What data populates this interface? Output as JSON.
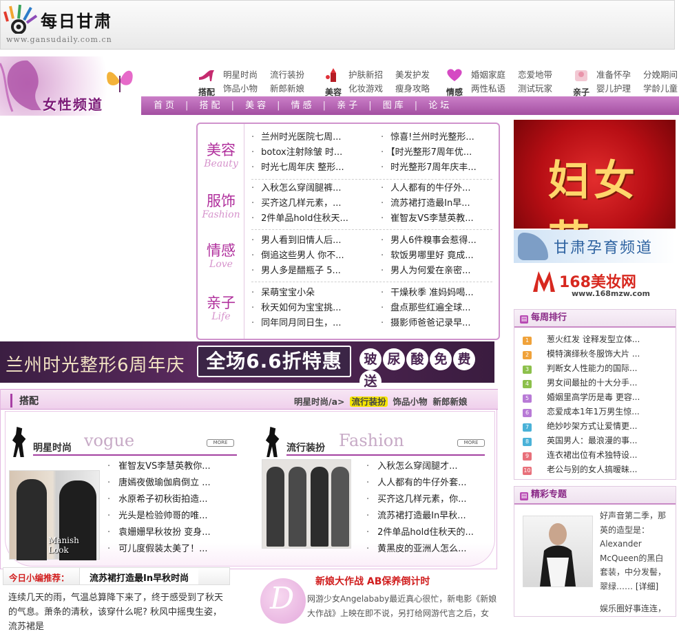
{
  "site": {
    "logo_text": "每日甘肃",
    "logo_url": "www.gansudaily.com.cn"
  },
  "channel": {
    "title": "女性频道",
    "categories": [
      {
        "icon": "high-heel-icon",
        "caption": "搭配",
        "links": [
          "明星时尚",
          "流行装扮",
          "饰品小物",
          "新郎新娘"
        ]
      },
      {
        "icon": "lipstick-icon",
        "caption": "美容",
        "links": [
          "护肤新招",
          "美发护发",
          "化妆游戏",
          "瘦身攻略"
        ]
      },
      {
        "icon": "heart-icon",
        "caption": "情感",
        "links": [
          "婚姻家庭",
          "恋爱地带",
          "两性私语",
          "测试玩家"
        ]
      },
      {
        "icon": "baby-icon",
        "caption": "亲子",
        "links": [
          "准备怀孕",
          "分娩期间",
          "婴儿护理",
          "学龄儿童"
        ]
      }
    ],
    "nav": [
      "首页",
      "搭配",
      "美容",
      "情感",
      "亲子",
      "图库",
      "论坛"
    ]
  },
  "topics": [
    {
      "cn": "美容",
      "en": "Beauty",
      "left": [
        "兰州时光医院七周...",
        "botox注射除皱 时...",
        "时光七周年庆 整形..."
      ],
      "right": [
        "惊喜!兰州时光整形...",
        "【时光整形7周年优...",
        "时光整形7周年庆丰..."
      ]
    },
    {
      "cn": "服饰",
      "en": "Fashion",
      "left": [
        "入秋怎么穿阔腿裤...",
        "买齐这几样元素，...",
        "2件单品hold住秋天..."
      ],
      "right": [
        "人人都有的牛仔外...",
        "流苏裙打造最In早...",
        "崔智友VS李慧英教..."
      ]
    },
    {
      "cn": "情感",
      "en": "Love",
      "left": [
        "男人看到旧情人后...",
        "倒追这些男人 你不...",
        "男人多是醋瓶子 5..."
      ],
      "right": [
        "男人6件糗事会惹得...",
        "软饭男哪里好 竟成...",
        "男人为何爱在亲密..."
      ]
    },
    {
      "cn": "亲子",
      "en": "Life",
      "left": [
        "呆萌宝宝小朵",
        "秋天如何为宝宝挑...",
        "同年同月同日生，..."
      ],
      "right": [
        "干燥秋季 准妈妈喝...",
        "盘点那些红遍全球...",
        "摄影师爸爸记录早..."
      ]
    }
  ],
  "right": {
    "ad1_text": "妇女节",
    "ad2_text": "甘肃孕育频道",
    "ad3_name": "168美妆网",
    "ad3_url": "www.168mzw.com",
    "rank_title": "每周排行",
    "rank": [
      {
        "no": "1",
        "title": "葱火红发 诠释发型立体...",
        "color": "#f0a23a"
      },
      {
        "no": "2",
        "title": "模特演绎秋冬服饰大片 ...",
        "color": "#f0a23a"
      },
      {
        "no": "3",
        "title": "判断女人性能力的国际...",
        "color": "#8cc04b"
      },
      {
        "no": "4",
        "title": "男女间最扯的十大分手...",
        "color": "#8cc04b"
      },
      {
        "no": "5",
        "title": "婚姻里高学历是毒 更容...",
        "color": "#b87ad6"
      },
      {
        "no": "6",
        "title": "恋爱成本1年1万男生惊...",
        "color": "#b87ad6"
      },
      {
        "no": "7",
        "title": "绝妙吵架方式让爱情更...",
        "color": "#4ab2d8"
      },
      {
        "no": "8",
        "title": "英国男人：最浪漫的事...",
        "color": "#4ab2d8"
      },
      {
        "no": "9",
        "title": "连衣裙出位有术独特设...",
        "color": "#e8707a"
      },
      {
        "no": "10",
        "title": "老公与别的女人搞暧昧...",
        "color": "#e8707a"
      }
    ],
    "special_title": "精彩专题",
    "special_text": "好声音第二季，那英的造型是：Alexander McQueen的黑白套装，中分发髻，翠绿……",
    "special_more": "[详细]",
    "special_text2": "娱乐圈好事连连，"
  },
  "promo": {
    "t1": "兰州时光整形6周年庆",
    "t2": "全场6.6折特惠",
    "pills": [
      "玻",
      "尿",
      "酸",
      "免",
      "费",
      "送"
    ]
  },
  "dapei": {
    "title": "搭配",
    "subs": [
      "明星时尚/a>",
      "流行装扮",
      "饰品小物",
      "新郎新娘"
    ],
    "left": {
      "cn": "明星时尚",
      "en": "vogue",
      "more": "MORE",
      "photo_label": "Manish Look",
      "items": [
        "崔智友VS李慧英教你...",
        "唐嫣夜傲瑜伽肩倒立 ...",
        "水原希子初秋街拍造...",
        "光头是检验帅哥的唯...",
        "袁姗姗早秋妆扮 变身...",
        "可儿度假装太美了！..."
      ]
    },
    "right": {
      "cn": "流行装扮",
      "en": "Fashion",
      "more": "MORE",
      "items": [
        "入秋怎么穿阔腿才...",
        "人人都有的牛仔外套...",
        "买齐这几样元素，你...",
        "流苏裙打造最In早秋...",
        "2件单品hold住秋天的...",
        "黄黑皮的亚洲人怎么..."
      ]
    }
  },
  "editor": {
    "label": "今日小编推荐：",
    "value": "流苏裙打造最In早秋时尚",
    "text": "连续几天的雨，气温总算降下来了，终于感受到了秋天的气息。萧条的清秋，该穿什么呢? 秋风中摇曳生姿，流苏裙是"
  },
  "bride": {
    "title": "新娘大作战 AB保养倒计时",
    "text": "网游少女Angelababy最近真心很忙，新电影《新娘大作战》上映在即不说，另打给网游代言之后，女"
  }
}
